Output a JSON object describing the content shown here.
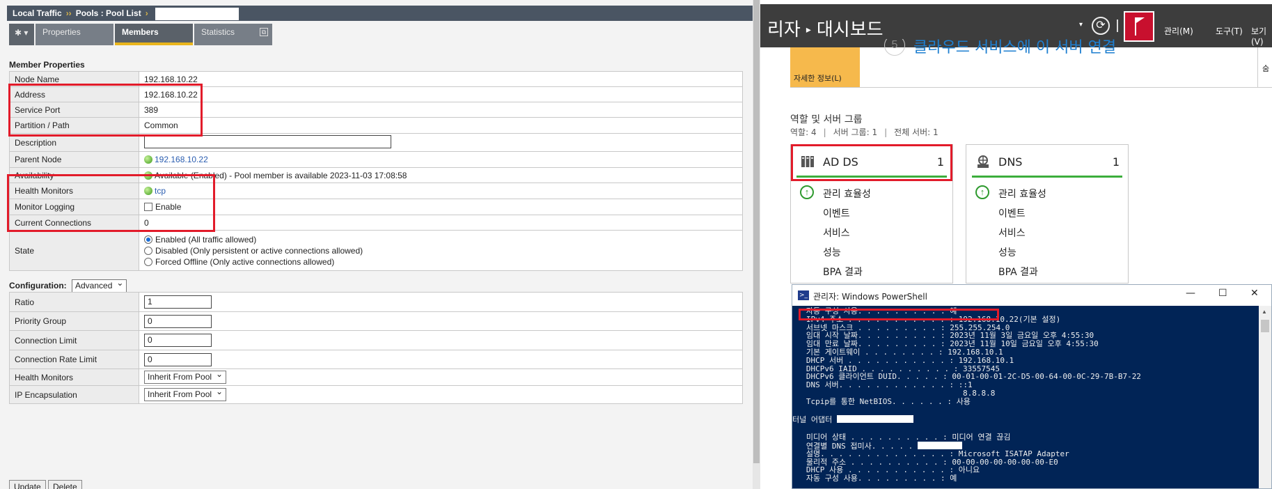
{
  "bigip": {
    "breadcrumb": {
      "section": "Local Traffic",
      "sep1": "››",
      "item1": "Pools : Pool List",
      "sep2": "›"
    },
    "tabs": {
      "gear": "✱",
      "gear_caret": "▾",
      "properties": "Properties",
      "members": "Members",
      "statistics": "Statistics",
      "statistics_icon": "⧉"
    },
    "member_properties": {
      "title": "Member Properties",
      "node_name": {
        "label": "Node Name",
        "value": "192.168.10.22"
      },
      "address": {
        "label": "Address",
        "value": "192.168.10.22"
      },
      "service_port": {
        "label": "Service Port",
        "value": "389"
      },
      "partition": {
        "label": "Partition / Path",
        "value": "Common"
      },
      "description": {
        "label": "Description",
        "value": ""
      },
      "parent_node": {
        "label": "Parent Node",
        "value": "192.168.10.22"
      },
      "availability": {
        "label": "Availability",
        "value": "Available (Enabled) - Pool member is available 2023-11-03 17:08:58"
      },
      "health_monitors": {
        "label": "Health Monitors",
        "value": "tcp"
      },
      "monitor_logging": {
        "label": "Monitor Logging",
        "value": "Enable"
      },
      "current_connections": {
        "label": "Current Connections",
        "value": "0"
      },
      "state": {
        "label": "State",
        "options": [
          "Enabled (All traffic allowed)",
          "Disabled (Only persistent or active connections allowed)",
          "Forced Offline (Only active connections allowed)"
        ]
      }
    },
    "configuration": {
      "title": "Configuration:",
      "mode": "Advanced",
      "ratio": {
        "label": "Ratio",
        "value": "1"
      },
      "priority_group": {
        "label": "Priority Group",
        "value": "0"
      },
      "connection_limit": {
        "label": "Connection Limit",
        "value": "0"
      },
      "connection_rate_limit": {
        "label": "Connection Rate Limit",
        "value": "0"
      },
      "health_monitors": {
        "label": "Health Monitors",
        "value": "Inherit From Pool"
      },
      "ip_encapsulation": {
        "label": "IP Encapsulation",
        "value": "Inherit From Pool"
      }
    },
    "buttons": {
      "update": "Update",
      "delete": "Delete"
    }
  },
  "server_manager": {
    "title_left": "리자",
    "title_arrow": "▸",
    "title_right": "대시보드",
    "caret": "▾",
    "refresh_icon": "⟳",
    "menu": {
      "manage": "관리(M)",
      "tools": "도구(T)",
      "view": "보기(V)"
    },
    "learn_more": "자세한 정보(L)",
    "step_number": "5",
    "step_text": "클라우드 서비스에 이 서버 연결",
    "edge_text": "숨",
    "roles_heading": "역할 및 서버 그룹",
    "roles_sub": {
      "roles": "역할: 4",
      "groups": "서버 그룹: 1",
      "total": "전체 서버: 1",
      "sep": "|"
    },
    "cards": [
      {
        "name": "AD DS",
        "count": "1",
        "items": [
          "관리 효율성",
          "이벤트",
          "서비스",
          "성능",
          "BPA 결과"
        ]
      },
      {
        "name": "DNS",
        "count": "1",
        "items": [
          "관리 효율성",
          "이벤트",
          "서비스",
          "성능",
          "BPA 결과"
        ]
      }
    ],
    "ok_icon": "↑"
  },
  "powershell": {
    "title": "관리자: Windows PowerShell",
    "icon_text": ">_",
    "controls": {
      "minimize": "—",
      "maximize": "☐",
      "close": "✕"
    },
    "scroll_up": "▲",
    "lines": [
      "   자동 구성 사용. . . . . . . . . : 예",
      "   IPv4 주소 . . . . . . . . . . . : 192.168.10.22(기본 설정)",
      "   서브넷 마스크 . . . . . . . . . : 255.255.254.0",
      "   임대 시작 날짜. . . . . . . . . : 2023년 11월 3일 금요일 오후 4:55:30",
      "   임대 만료 날짜. . . . . . . . . : 2023년 11월 10일 금요일 오후 4:55:30",
      "   기본 게이트웨이 . . . . . . . . : 192.168.10.1",
      "   DHCP 서버 . . . . . . . . . . . : 192.168.10.1",
      "   DHCPv6 IAID . . . . . . . . . . : 33557545",
      "   DHCPv6 클라이언트 DUID. . . . . : 00-01-00-01-2C-D5-00-64-00-0C-29-7B-B7-22",
      "   DNS 서버. . . . . . . . . . . . : ::1",
      "                                     8.8.8.8",
      "   Tcpip를 통한 NetBIOS. . . . . . : 사용",
      "",
      "터널 어댑터 ",
      "",
      "   미디어 상태 . . . . . . . . . . : 미디어 연결 끊김",
      "   연결별 DNS 접미사. . . . . ",
      "   설명. . . . . . . . . . . . . . : Microsoft ISATAP Adapter",
      "   물리적 주소 . . . . . . . . . . : 00-00-00-00-00-00-00-E0",
      "   DHCP 사용 . . . . . . . . . . . : 아니요",
      "   자동 구성 사용. . . . . . . . . : 예"
    ]
  }
}
